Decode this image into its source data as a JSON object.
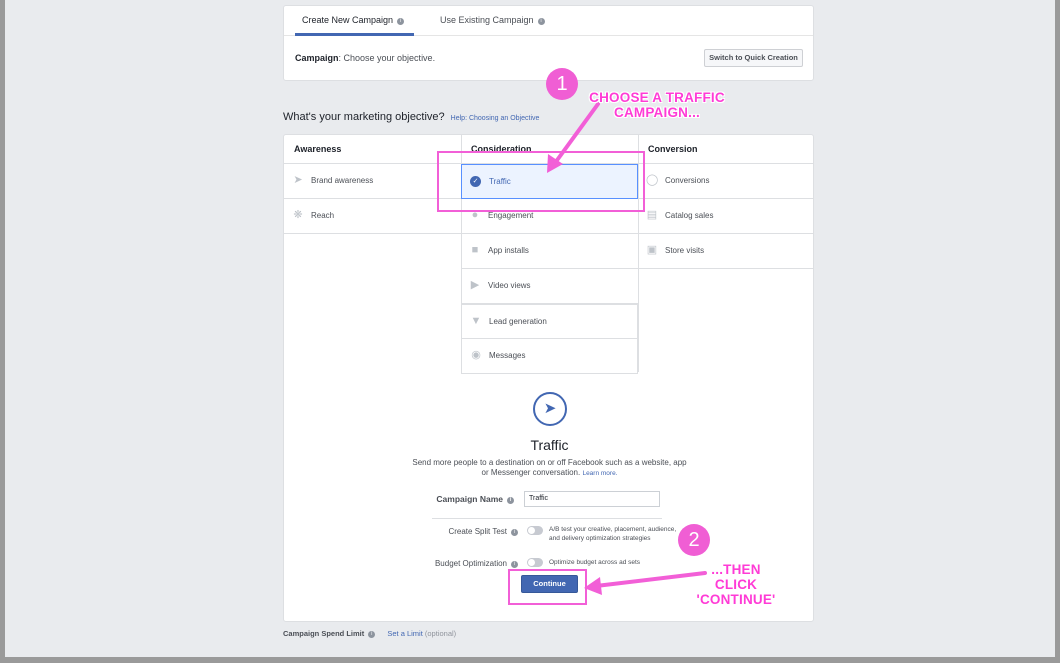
{
  "tabs": {
    "create_new": "Create New Campaign",
    "use_existing": "Use Existing Campaign"
  },
  "campaign_line": {
    "label": "Campaign",
    "text": ": Choose your objective."
  },
  "quick_creation_label": "Switch to Quick Creation",
  "objective": {
    "heading": "What's your marketing objective?",
    "help": "Help: Choosing an Objective"
  },
  "columns": {
    "awareness": {
      "title": "Awareness",
      "items": [
        "Brand awareness",
        "Reach"
      ]
    },
    "consideration": {
      "title": "Consideration",
      "items": [
        "Traffic",
        "Engagement",
        "App installs",
        "Video views",
        "Lead generation",
        "Messages"
      ]
    },
    "conversion": {
      "title": "Conversion",
      "items": [
        "Conversions",
        "Catalog sales",
        "Store visits"
      ]
    }
  },
  "selected_objective": "Traffic",
  "detail": {
    "title": "Traffic",
    "description": "Send more people to a destination on or off Facebook such as a website, app or Messenger conversation.",
    "learn_more": "Learn more."
  },
  "form": {
    "campaign_name_label": "Campaign Name",
    "campaign_name_value": "Traffic",
    "split_test_label": "Create Split Test",
    "split_test_desc": "A/B test your creative, placement, audience, and delivery optimization strategies",
    "budget_label": "Budget Optimization",
    "budget_desc": "Optimize budget across ad sets",
    "continue_label": "Continue"
  },
  "spend_limit": {
    "label": "Campaign Spend Limit",
    "link": "Set a Limit",
    "optional": "(optional)"
  },
  "annotations": {
    "badge1": "1",
    "callout1_line1": "CHOOSE A TRAFFIC",
    "callout1_line2": "CAMPAIGN...",
    "badge2": "2",
    "callout2_line1": "...THEN",
    "callout2_line2": "CLICK",
    "callout2_line3": "'CONTINUE'",
    "color": "#f25fd7"
  },
  "colors": {
    "accent": "#4267b2",
    "background": "#e9ebee"
  }
}
